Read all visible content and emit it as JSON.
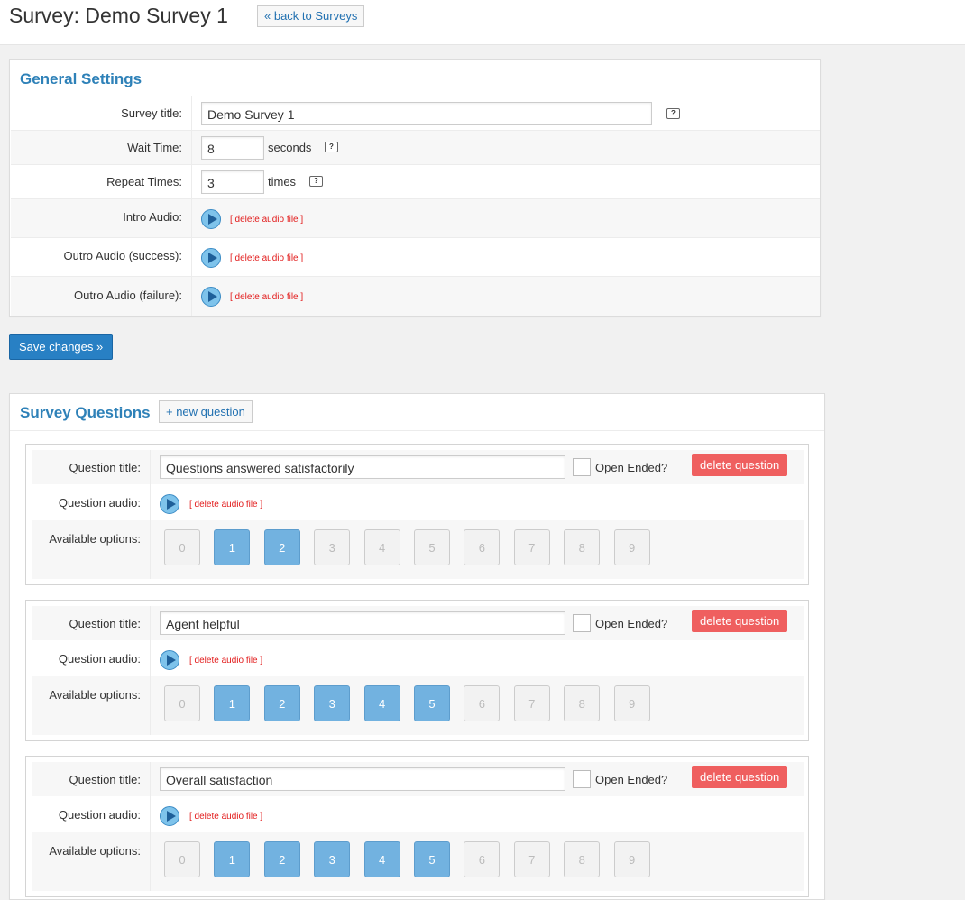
{
  "header": {
    "title": "Survey: Demo Survey 1",
    "back_label": "« back to Surveys"
  },
  "general": {
    "title": "General Settings",
    "survey_title_label": "Survey title:",
    "survey_title_value": "Demo Survey 1",
    "wait_label": "Wait Time:",
    "wait_value": "8",
    "wait_unit": "seconds",
    "repeat_label": "Repeat Times:",
    "repeat_value": "3",
    "repeat_unit": "times",
    "intro_label": "Intro Audio:",
    "outro_success_label": "Outro Audio (success):",
    "outro_failure_label": "Outro Audio (failure):",
    "delete_audio": "[ delete audio file ]",
    "help_glyph": "?"
  },
  "save_label": "Save changes »",
  "questions": {
    "title": "Survey Questions",
    "new_label": "+ new question",
    "title_label": "Question title:",
    "audio_label": "Question audio:",
    "options_label": "Available options:",
    "open_ended_label": "Open Ended?",
    "delete_label": "delete question",
    "delete_audio": "[ delete audio file ]",
    "option_values": [
      "0",
      "1",
      "2",
      "3",
      "4",
      "5",
      "6",
      "7",
      "8",
      "9"
    ],
    "items": [
      {
        "title": "Questions answered satisfactorily",
        "open_ended": false,
        "selected": [
          "1",
          "2"
        ]
      },
      {
        "title": "Agent helpful",
        "open_ended": false,
        "selected": [
          "1",
          "2",
          "3",
          "4",
          "5"
        ]
      },
      {
        "title": "Overall satisfaction",
        "open_ended": false,
        "selected": [
          "1",
          "2",
          "3",
          "4",
          "5"
        ]
      }
    ]
  },
  "colors": {
    "accent": "#2e81b8",
    "save_button": "#2880c4",
    "delete_button": "#ef5f5f",
    "option_selected": "#72b2e0",
    "delete_audio_text": "#e21b1b"
  },
  "icons": [
    "help-icon",
    "play-icon"
  ]
}
